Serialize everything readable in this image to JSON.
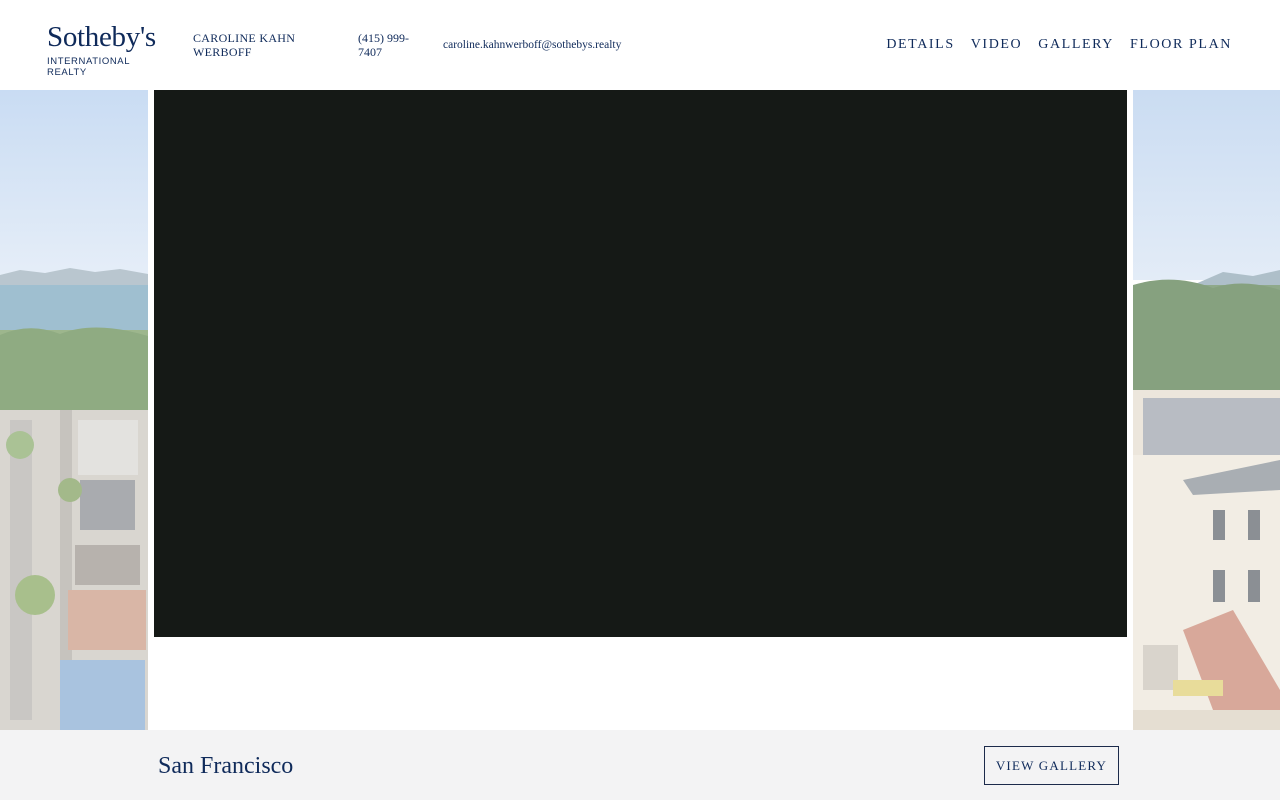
{
  "header": {
    "logo": {
      "wordmark": "Sotheby's",
      "subtitle": "INTERNATIONAL REALTY"
    },
    "agent": {
      "name": "CAROLINE KAHN WERBOFF",
      "phone": "(415) 999-7407",
      "email": "caroline.kahnwerboff@sothebys.realty"
    },
    "nav": [
      {
        "label": "DETAILS"
      },
      {
        "label": "VIDEO"
      },
      {
        "label": "GALLERY"
      },
      {
        "label": "FLOOR PLAN"
      }
    ]
  },
  "hero": {
    "video_background": "#151916",
    "left_image": "aerial-city-bay-photo",
    "right_image": "victorian-mansion-photo"
  },
  "footer": {
    "city": "San Francisco",
    "view_gallery_label": "VIEW GALLERY"
  },
  "colors": {
    "brand_navy": "#0f2a5a",
    "footer_bg": "#f3f3f4"
  }
}
